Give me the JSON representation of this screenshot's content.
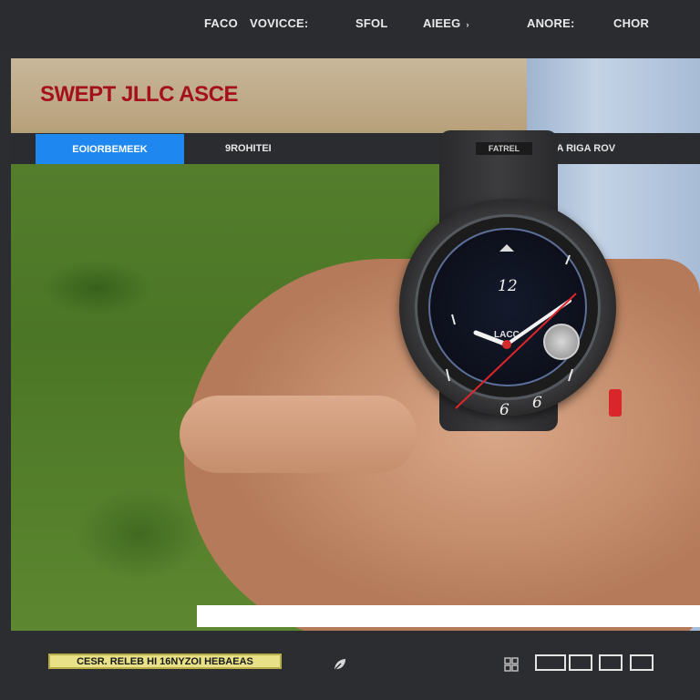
{
  "topnav": {
    "items": [
      {
        "label": "FACO"
      },
      {
        "label": "VOVICCE:"
      },
      {
        "label": "SFOL"
      },
      {
        "label": "AIEEG",
        "caret": "›"
      },
      {
        "label": "ANORE:"
      },
      {
        "label": "CHOR"
      }
    ]
  },
  "hero": {
    "title": "SWEPT JLLC ASCE"
  },
  "subnav": {
    "active_tab": "EOIORBEMEEK",
    "tab2": "9ROHITEI",
    "tab3": "LEGTA RIGA ROV"
  },
  "watch": {
    "strap_label": "FATREL",
    "brand": "LACC",
    "numbers": [
      "12",
      "6",
      "6"
    ]
  },
  "footer": {
    "label": "CESR. RELEB HI 16NYZOI HEBAEAS",
    "icons": {
      "leaf": "leaf-icon",
      "grid": "grid-icon"
    }
  },
  "colors": {
    "accent": "#1f87f0",
    "title_red": "#a4111a",
    "footer_label_bg": "#e8e187",
    "nav_bg": "#2b2c30"
  }
}
